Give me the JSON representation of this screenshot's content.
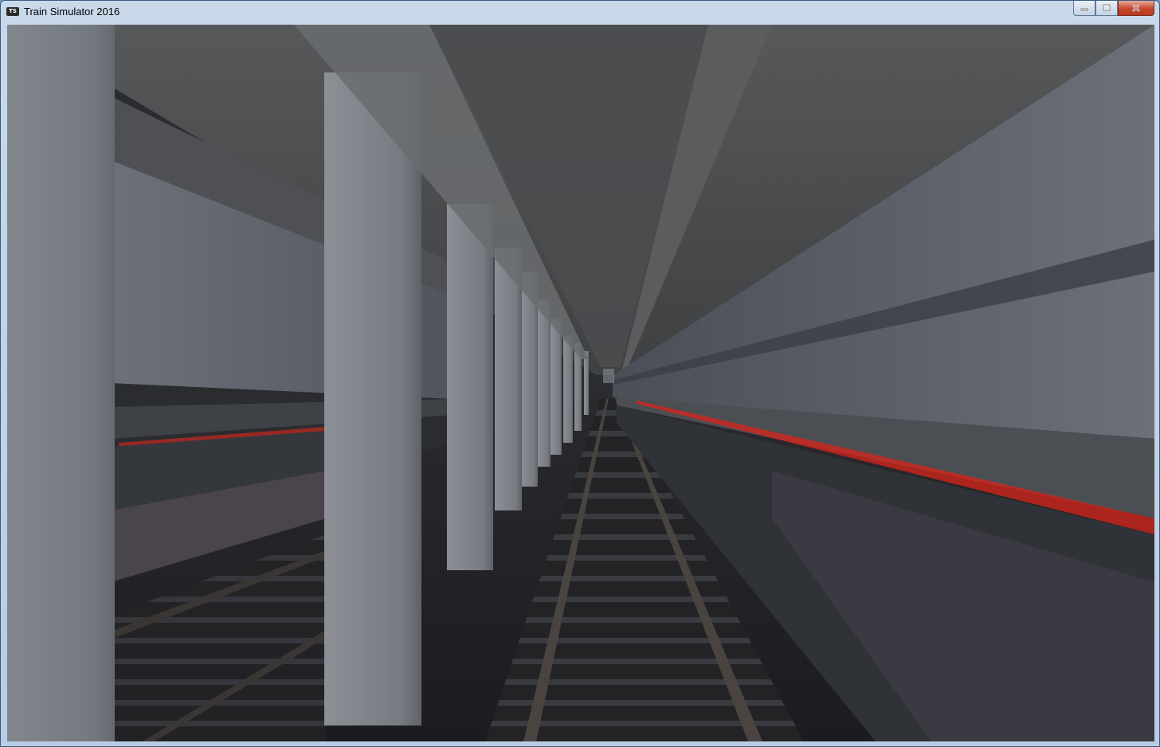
{
  "window": {
    "title": "Train Simulator 2016",
    "icon": "ts-app-icon",
    "controls": [
      "minimize-icon",
      "maximize-icon",
      "close-icon"
    ]
  },
  "scene": {
    "description_icon": "3d-viewport",
    "colors": {
      "concrete": "#7c8188",
      "ceiling": "#55575a",
      "rail": "#3a3633",
      "ballast": "#1f1f22",
      "cable_red": "#d8241a"
    }
  }
}
